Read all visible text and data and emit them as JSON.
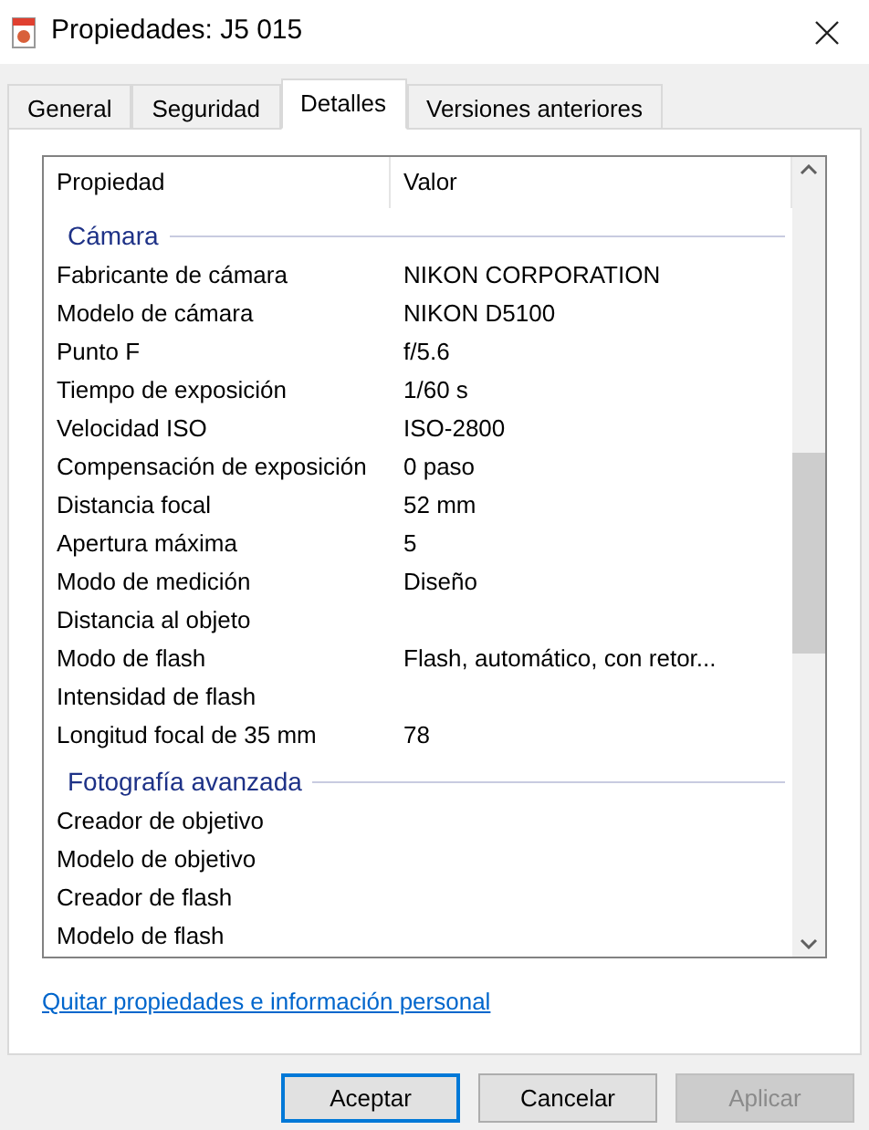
{
  "window": {
    "title": "Propiedades: J5 015"
  },
  "tabs": [
    {
      "label": "General",
      "selected": false
    },
    {
      "label": "Seguridad",
      "selected": false
    },
    {
      "label": "Detalles",
      "selected": true
    },
    {
      "label": "Versiones anteriores",
      "selected": false
    }
  ],
  "table": {
    "columns": [
      "Propiedad",
      "Valor"
    ],
    "rows": [
      {
        "kind": "group",
        "label": "Cámara"
      },
      {
        "kind": "row",
        "property": "Fabricante de cámara",
        "value": "NIKON CORPORATION"
      },
      {
        "kind": "row",
        "property": "Modelo de cámara",
        "value": "NIKON D5100"
      },
      {
        "kind": "row",
        "property": "Punto F",
        "value": "f/5.6"
      },
      {
        "kind": "row",
        "property": "Tiempo de exposición",
        "value": "1/60 s"
      },
      {
        "kind": "row",
        "property": "Velocidad ISO",
        "value": "ISO-2800"
      },
      {
        "kind": "row",
        "property": "Compensación de exposición",
        "value": "0 paso"
      },
      {
        "kind": "row",
        "property": "Distancia focal",
        "value": "52 mm"
      },
      {
        "kind": "row",
        "property": "Apertura máxima",
        "value": "5"
      },
      {
        "kind": "row",
        "property": "Modo de medición",
        "value": "Diseño"
      },
      {
        "kind": "row",
        "property": "Distancia al objeto"
      },
      {
        "kind": "row",
        "property": "Modo de flash",
        "value": "Flash, automático, con retor..."
      },
      {
        "kind": "row",
        "property": "Intensidad de flash"
      },
      {
        "kind": "row",
        "property": "Longitud focal de 35 mm",
        "value": "78"
      },
      {
        "kind": "group",
        "label": "Fotografía avanzada"
      },
      {
        "kind": "row",
        "property": "Creador de objetivo"
      },
      {
        "kind": "row",
        "property": "Modelo de objetivo"
      },
      {
        "kind": "row",
        "property": "Creador de flash"
      },
      {
        "kind": "row",
        "property": "Modelo de flash"
      }
    ]
  },
  "link": "Quitar propiedades e información personal",
  "buttons": [
    {
      "label": "Aceptar",
      "disabled": false,
      "default": true
    },
    {
      "label": "Cancelar",
      "disabled": false,
      "default": false
    },
    {
      "label": "Aplicar",
      "disabled": true,
      "default": false
    }
  ]
}
